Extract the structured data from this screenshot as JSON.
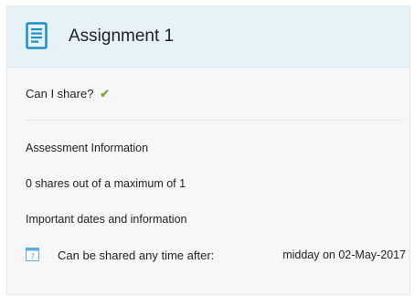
{
  "header": {
    "title": "Assignment 1",
    "icon": "assignment-document-icon"
  },
  "share": {
    "question": "Can I share?",
    "status_icon": "checkmark-icon",
    "status_color": "#7cae36"
  },
  "assessment": {
    "heading": "Assessment Information",
    "shares_text": "0 shares out of a maximum of 1"
  },
  "dates": {
    "heading": "Important dates and information",
    "share_after_label": "Can be shared any time after:",
    "share_after_value": "midday on 02-May-2017",
    "calendar_day": "7"
  },
  "colors": {
    "header_bg": "#e6f2f8",
    "accent_blue": "#1d8fce",
    "card_bg": "#f7f7f7"
  }
}
